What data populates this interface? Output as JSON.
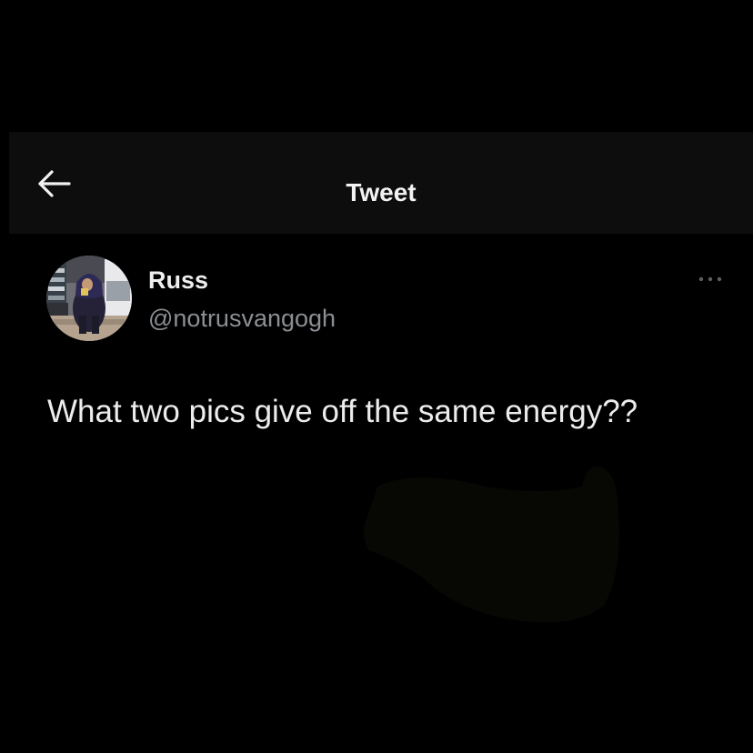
{
  "header": {
    "title": "Tweet",
    "back_icon": "arrow-left-icon"
  },
  "tweet": {
    "author": {
      "display_name": "Russ",
      "handle": "@notrusvangogh",
      "avatar": "profile-photo"
    },
    "more_icon": "more-horizontal-icon",
    "text": "What two pics give off the same energy??"
  },
  "colors": {
    "background": "#000000",
    "header_background": "#0d0d0d",
    "primary_text": "#e7e9ea",
    "secondary_text": "#8b8f94"
  }
}
